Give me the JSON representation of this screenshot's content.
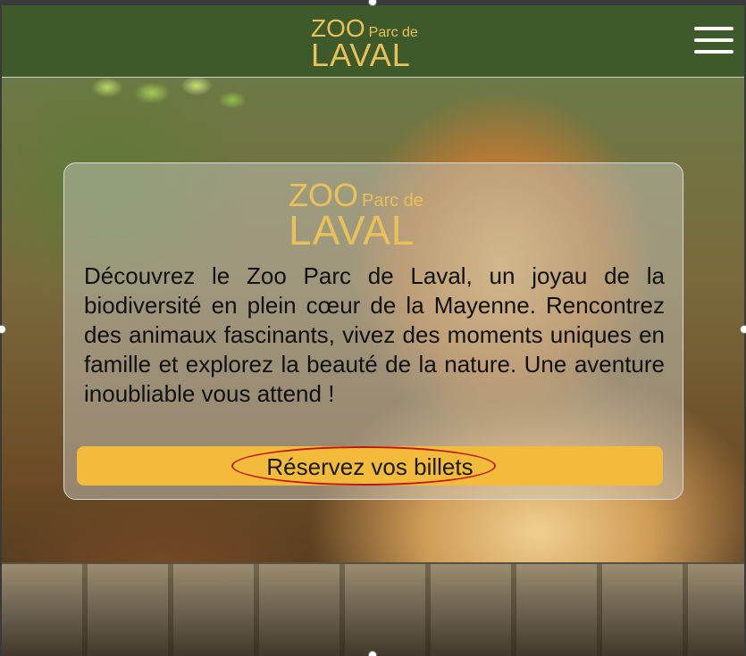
{
  "nav": {
    "logo": {
      "zoo": "ZOO",
      "parc": "Parc de",
      "laval": "LAVAL"
    },
    "menu_icon": "hamburger-menu-icon"
  },
  "hero": {
    "logo": {
      "zoo": "ZOO",
      "parc": "Parc de",
      "laval": "LAVAL"
    },
    "description": "Découvrez le Zoo Parc de Laval, un joyau de la biodiversité en plein cœur de la Mayenne. Rencontrez des animaux fascinants, vivez des moments uniques en famille et explorez la beauté de la nature. Une aventure inoubliable vous attend !",
    "cta_label": "Réservez vos billets"
  },
  "colors": {
    "nav_bg": "#3f5a2a",
    "logo_gold": "#e8c15a",
    "cta_bg": "#f3bb3c",
    "highlight_ring": "#c01818"
  }
}
